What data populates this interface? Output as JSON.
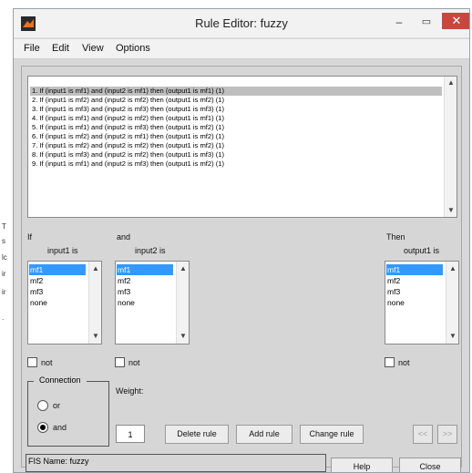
{
  "window": {
    "title": "Rule Editor: fuzzy",
    "minimize": "–",
    "maximize": "▭",
    "close": "✕"
  },
  "menu": [
    "File",
    "Edit",
    "View",
    "Options"
  ],
  "rules": [
    "1. If (input1 is mf1) and (input2 is mf1) then (output1 is mf1) (1)",
    "2. If (input1 is mf2) and (input2 is mf2) then (output1 is mf2) (1)",
    "3. If (input1 is mf3) and (input2 is mf3) then (output1 is mf3) (1)",
    "4. If (input1 is mf1) and (input2 is mf2) then (output1 is mf1) (1)",
    "5. If (input1 is mf1) and (input2 is mf3) then (output1 is mf2) (1)",
    "6. If (input1 is mf2) and (input2 is mf1) then (output1 is mf2) (1)",
    "7. If (input1 is mf2) and (input2 is mf2) then (output1 is mf2) (1)",
    "8. If (input1 is mf3) and (input2 is mf2) then (output1 is mf3) (1)",
    "9. If (input1 is mf1) and (input2 is mf3) then (output1 is mf2) (1)"
  ],
  "selected_rule": 0,
  "if_label": "If",
  "and_label": "and",
  "then_label": "Then",
  "input1_label": "input1 is",
  "input2_label": "input2 is",
  "output1_label": "output1 is",
  "input1_options": [
    "mf1",
    "mf2",
    "mf3",
    "none"
  ],
  "input2_options": [
    "mf1",
    "mf2",
    "mf3",
    "none"
  ],
  "output1_options": [
    "mf1",
    "mf2",
    "mf3",
    "none"
  ],
  "not_label": "not",
  "connection": {
    "title": "Connection",
    "or_label": "or",
    "and_label": "and",
    "selected": "and"
  },
  "weight": {
    "label": "Weight:",
    "value": "1"
  },
  "buttons": {
    "delete_rule": "Delete rule",
    "add_rule": "Add rule",
    "change_rule": "Change rule",
    "prev": "<<",
    "next": ">>",
    "help": "Help",
    "close": "Close"
  },
  "fis_name": "FIS Name: fuzzy",
  "left_edge_marks": [
    "T",
    "s",
    "lc",
    "ir",
    "ir",
    "."
  ]
}
